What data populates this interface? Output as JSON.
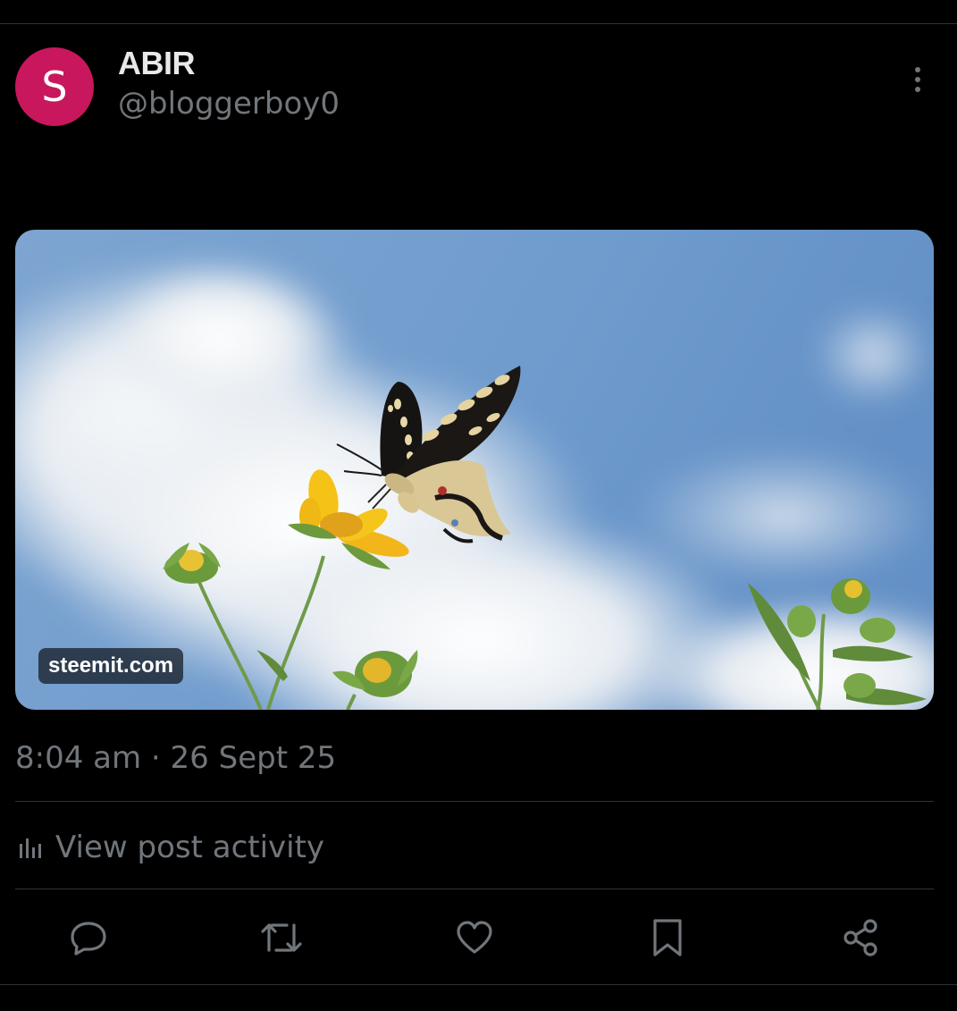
{
  "post": {
    "author": {
      "avatar_initial": "S",
      "avatar_color": "#c8175d",
      "display_name": "ABIR",
      "handle": "@bloggerboy0"
    },
    "media": {
      "source_label": "steemit.com"
    },
    "timestamp": "8:04 am · 26 Sept 25",
    "activity_label": "View post activity",
    "actions": [
      {
        "name": "reply",
        "icon": "speech-bubble-icon"
      },
      {
        "name": "repost",
        "icon": "repost-arrows-icon"
      },
      {
        "name": "like",
        "icon": "heart-icon"
      },
      {
        "name": "bookmark",
        "icon": "bookmark-icon"
      },
      {
        "name": "share",
        "icon": "share-nodes-icon"
      }
    ]
  },
  "colors": {
    "background": "#000000",
    "primary_text": "#e7e9ea",
    "secondary_text": "#71767b",
    "divider": "#2f3336"
  }
}
